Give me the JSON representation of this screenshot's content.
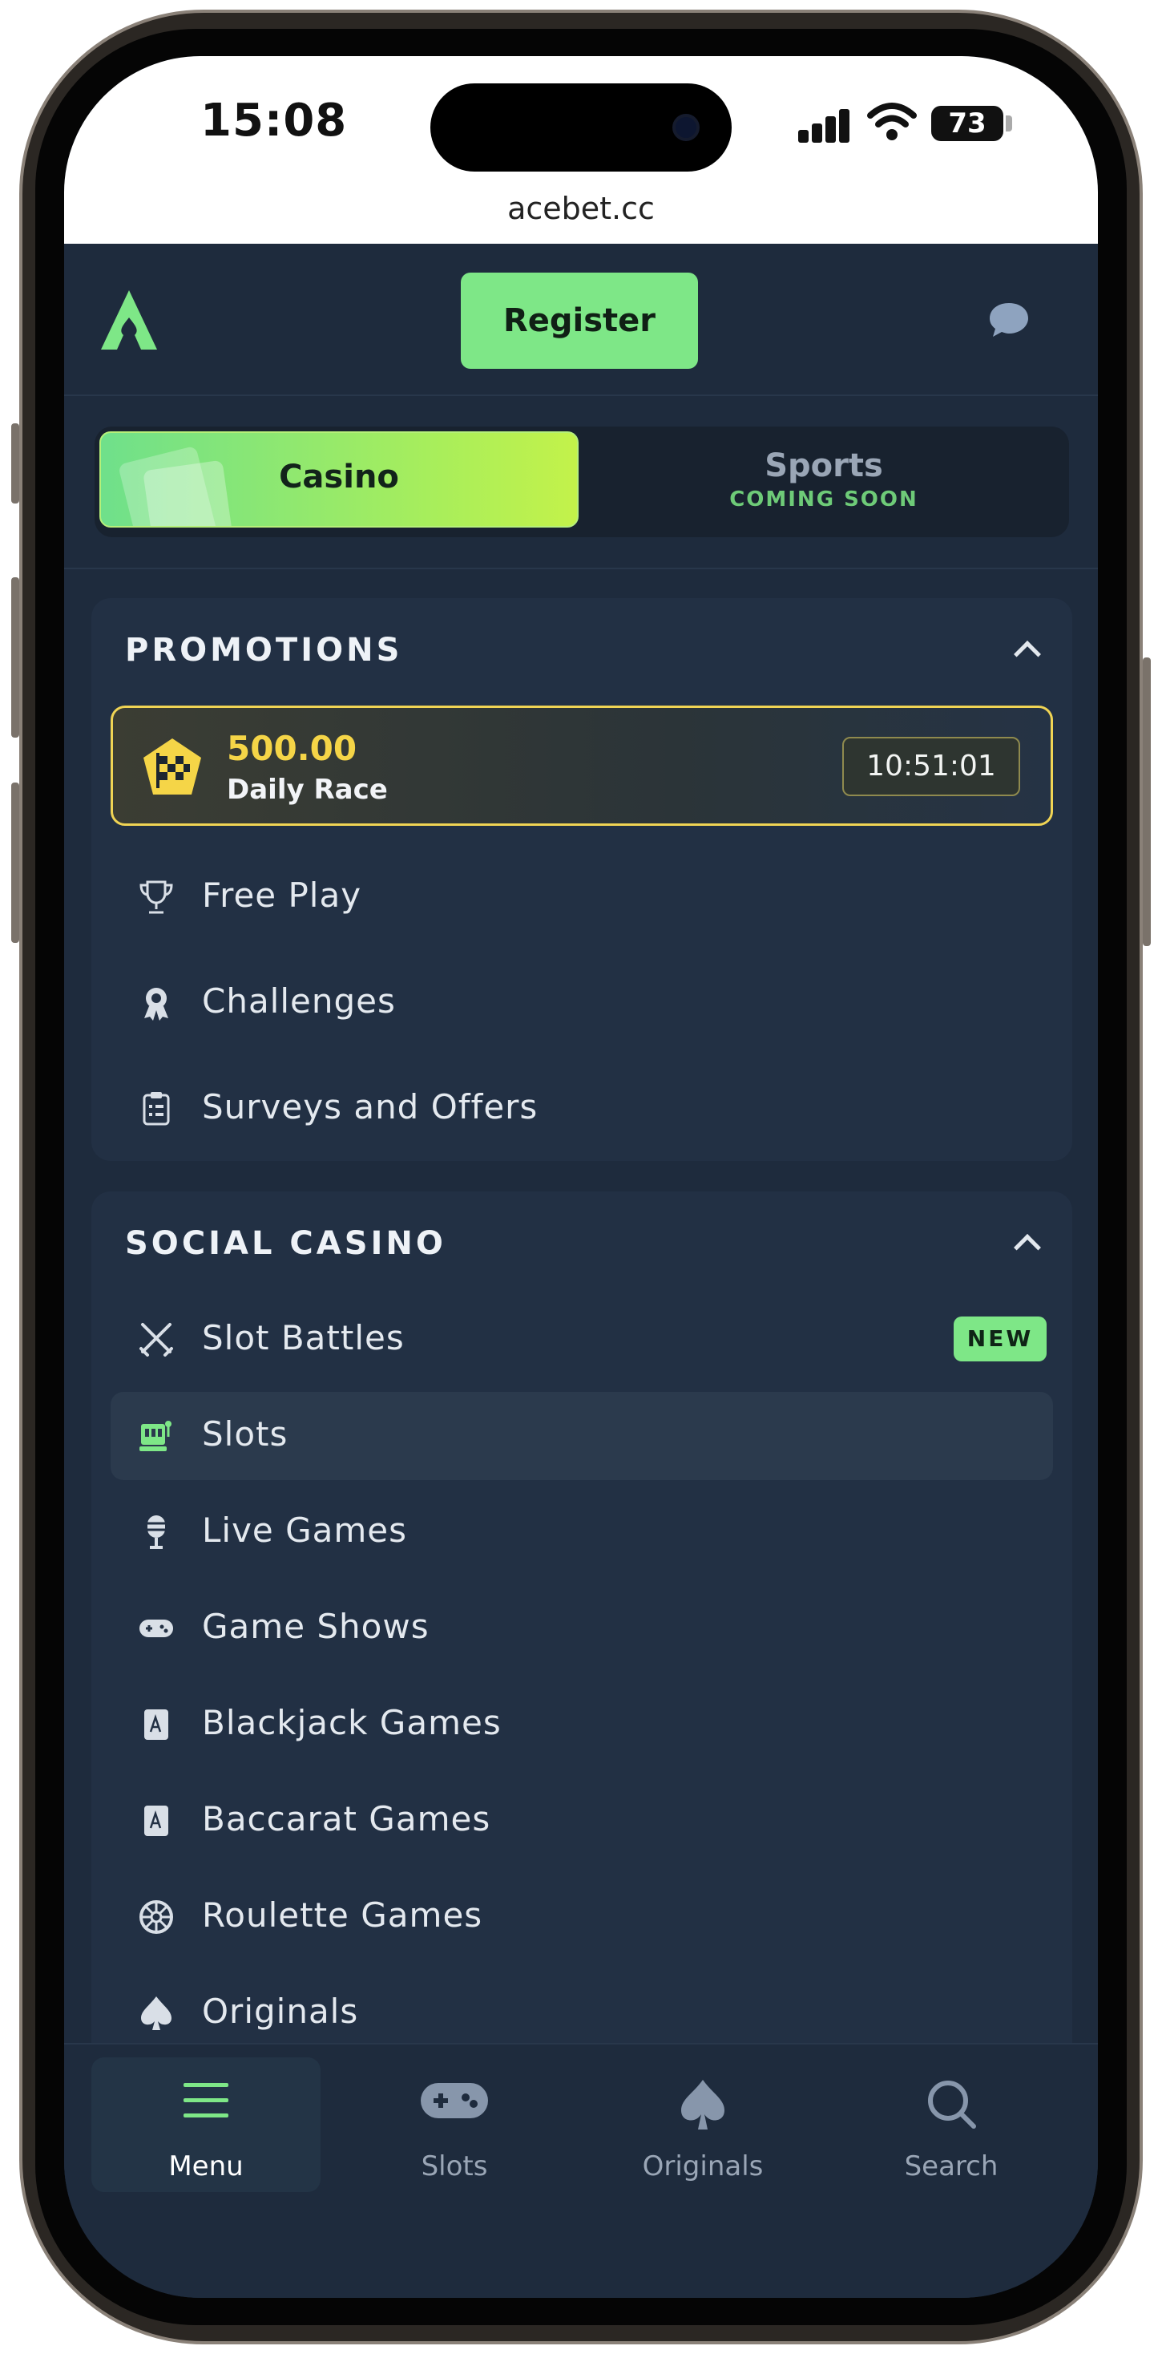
{
  "status_bar": {
    "time": "15:08",
    "battery": "73",
    "url": "acebet.cc"
  },
  "header": {
    "register_label": "Register"
  },
  "mode_switch": {
    "casino_label": "Casino",
    "sports_label": "Sports",
    "sports_sub": "COMING SOON"
  },
  "promotions": {
    "title": "PROMOTIONS",
    "race": {
      "amount": "500.00",
      "name": "Daily Race",
      "timer": "10:51:01"
    },
    "items": [
      {
        "label": "Free Play",
        "icon": "trophy-icon"
      },
      {
        "label": "Challenges",
        "icon": "award-ribbon-icon"
      },
      {
        "label": "Surveys and Offers",
        "icon": "clipboard-icon"
      }
    ]
  },
  "social_casino": {
    "title": "SOCIAL CASINO",
    "items": [
      {
        "label": "Slot Battles",
        "icon": "crossed-swords-icon",
        "badge": "NEW"
      },
      {
        "label": "Slots",
        "icon": "slot-machine-icon",
        "active": true
      },
      {
        "label": "Live Games",
        "icon": "microphone-icon"
      },
      {
        "label": "Game Shows",
        "icon": "gamepad-icon"
      },
      {
        "label": "Blackjack Games",
        "icon": "playing-card-icon"
      },
      {
        "label": "Baccarat Games",
        "icon": "playing-card-icon"
      },
      {
        "label": "Roulette Games",
        "icon": "roulette-wheel-icon"
      },
      {
        "label": "Originals",
        "icon": "spade-icon"
      }
    ]
  },
  "bottom_nav": [
    {
      "label": "Menu",
      "icon": "menu-icon",
      "active": true
    },
    {
      "label": "Slots",
      "icon": "gamepad-icon"
    },
    {
      "label": "Originals",
      "icon": "spade-icon"
    },
    {
      "label": "Search",
      "icon": "search-icon"
    }
  ],
  "colors": {
    "accent": "#7ee787",
    "background": "#1e2b3d",
    "panel": "#223044",
    "gold": "#f5d547"
  }
}
